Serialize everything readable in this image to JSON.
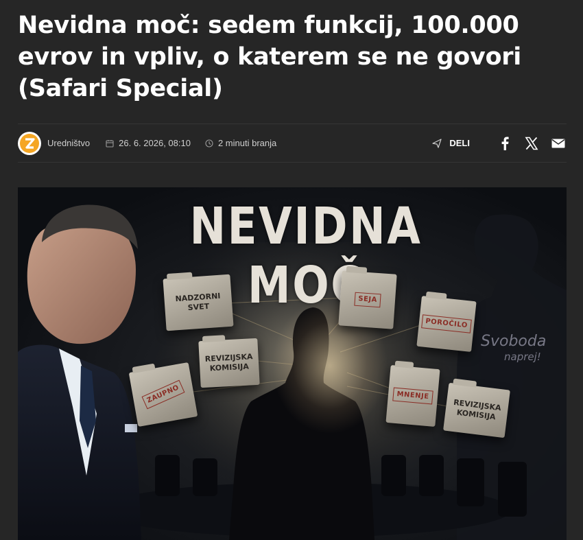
{
  "article": {
    "title": "Nevidna moč: sedem funkcij, 100.000 evrov in vpliv, o katerem se ne govori (Safari Special)"
  },
  "meta": {
    "author": "Uredništvo",
    "date": "26. 6. 2026, 08:10",
    "read_time": "2 minuti branja"
  },
  "share": {
    "label": "DELI",
    "buttons": [
      "facebook-icon",
      "x-icon",
      "mail-icon"
    ]
  },
  "hero": {
    "title": "NEVIDNA MOČ",
    "folders": {
      "nadzorni_svet": "NADZORNI SVET",
      "seja": "SEJA",
      "porocilo": "POROČILO",
      "revizijska_komisija_1": "REVIZIJSKA KOMISIJA",
      "zaupno": "ZAUPNO",
      "mnenje": "MNENJE",
      "revizijska_komisija_2": "REVIZIJSKA KOMISIJA"
    },
    "poster_line1": "Svoboda",
    "poster_line2": "naprej!"
  },
  "colors": {
    "background": "#262626",
    "logo_accent": "#f5a623",
    "text": "#ffffff"
  }
}
